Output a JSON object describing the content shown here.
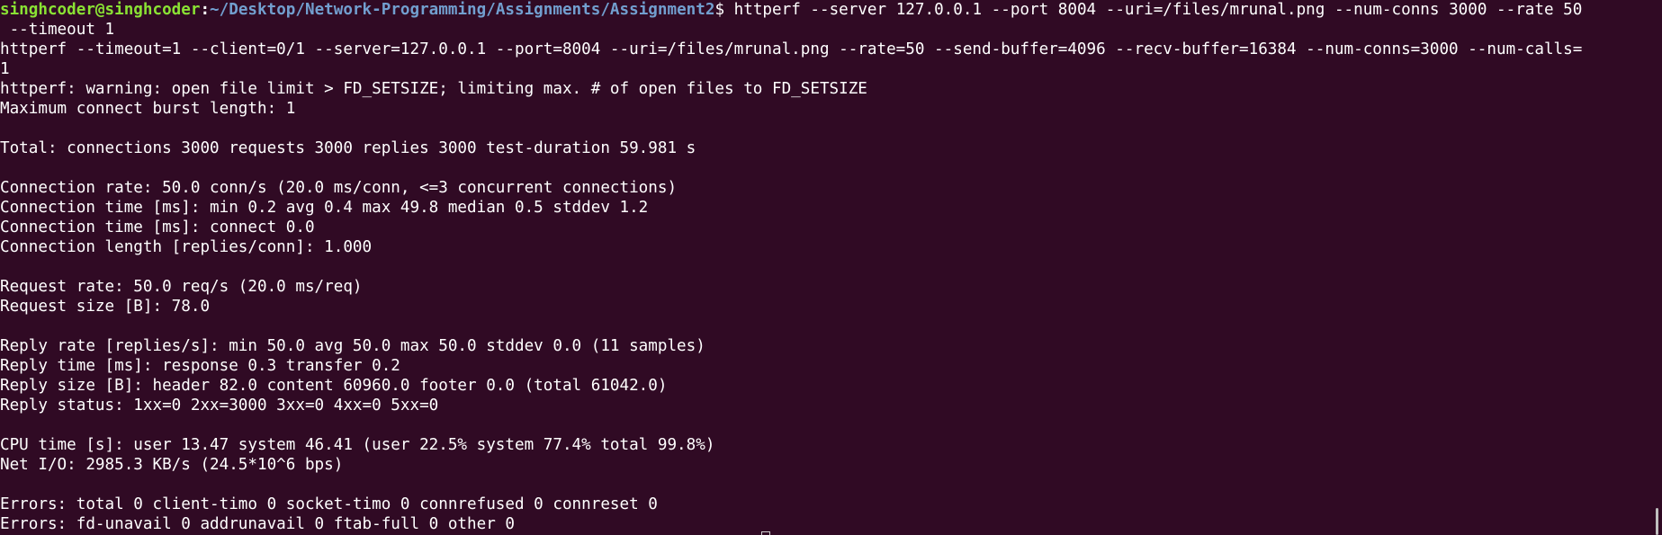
{
  "prompt": {
    "user_host": "singhcoder@singhcoder",
    "separator": ":",
    "path": "~/Desktop/Network-Programming/Assignments/Assignment2",
    "symbol": "$",
    "command": " httperf --server 127.0.0.1 --port 8004 --uri=/files/mrunal.png --num-conns 3000 --rate 50"
  },
  "output_lines": [
    " --timeout 1",
    "httperf --timeout=1 --client=0/1 --server=127.0.0.1 --port=8004 --uri=/files/mrunal.png --rate=50 --send-buffer=4096 --recv-buffer=16384 --num-conns=3000 --num-calls=",
    "1",
    "httperf: warning: open file limit > FD_SETSIZE; limiting max. # of open files to FD_SETSIZE",
    "Maximum connect burst length: 1",
    "",
    "Total: connections 3000 requests 3000 replies 3000 test-duration 59.981 s",
    "",
    "Connection rate: 50.0 conn/s (20.0 ms/conn, <=3 concurrent connections)",
    "Connection time [ms]: min 0.2 avg 0.4 max 49.8 median 0.5 stddev 1.2",
    "Connection time [ms]: connect 0.0",
    "Connection length [replies/conn]: 1.000",
    "",
    "Request rate: 50.0 req/s (20.0 ms/req)",
    "Request size [B]: 78.0",
    "",
    "Reply rate [replies/s]: min 50.0 avg 50.0 max 50.0 stddev 0.0 (11 samples)",
    "Reply time [ms]: response 0.3 transfer 0.2",
    "Reply size [B]: header 82.0 content 60960.0 footer 0.0 (total 61042.0)",
    "Reply status: 1xx=0 2xx=3000 3xx=0 4xx=0 5xx=0",
    "",
    "CPU time [s]: user 13.47 system 46.41 (user 22.5% system 77.4% total 99.8%)",
    "Net I/O: 2985.3 KB/s (24.5*10^6 bps)",
    "",
    "Errors: total 0 client-timo 0 socket-timo 0 connrefused 0 connreset 0",
    "Errors: fd-unavail 0 addrunavail 0 ftab-full 0 other 0"
  ],
  "colors": {
    "background": "#300a24",
    "text": "#ffffff",
    "user_host": "#8ae234",
    "path": "#729fcf"
  }
}
